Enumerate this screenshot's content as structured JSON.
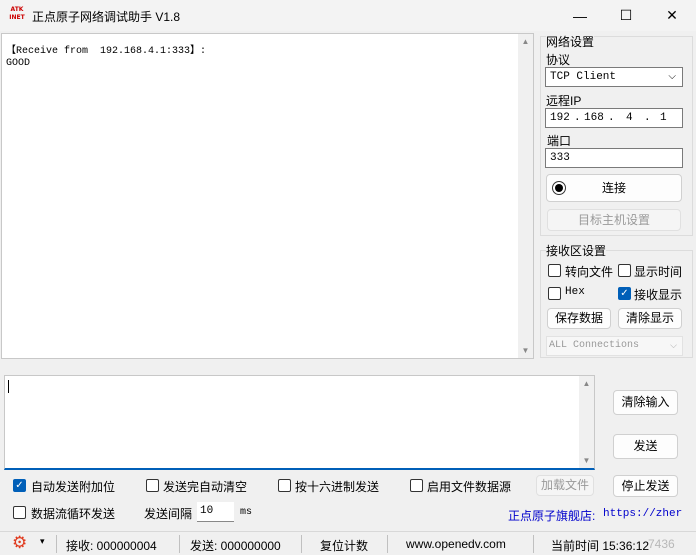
{
  "window": {
    "title": "正点原子网络调试助手 V1.8",
    "icon_text": "ATK\nINET",
    "minimize": "—",
    "maximize": "☐",
    "close": "✕"
  },
  "receive": {
    "text": "【Receive from  192.168.4.1:333】:\nGOOD"
  },
  "net": {
    "group_title": "网络设置",
    "protocol_label": "协议",
    "protocol_value": "TCP Client",
    "remote_ip_label": "远程IP",
    "ip": [
      "192",
      "168",
      "4",
      "1"
    ],
    "port_label": "端口",
    "port_value": "333",
    "connect_label": "连接",
    "target_host_label": "目标主机设置"
  },
  "recv_settings": {
    "group_title": "接收区设置",
    "to_file": "转向文件",
    "show_time": "显示时间",
    "hex": "Hex",
    "recv_show": "接收显示",
    "save_data": "保存数据",
    "clear_display": "清除显示",
    "connections": "ALL Connections"
  },
  "send_panel": {
    "clear_input": "清除输入",
    "send": "发送",
    "stop_send": "停止发送"
  },
  "options": {
    "auto_append": "自动发送附加位",
    "clear_after_send": "发送完自动清空",
    "hex_send": "按十六进制发送",
    "file_source": "启用文件数据源",
    "load_file": "加载文件",
    "loop_send": "数据流循环发送",
    "interval_label": "发送间隔",
    "interval_value": "10",
    "interval_unit": "ms",
    "flagship_label": "正点原子旗舰店:",
    "flagship_url": "https://zher"
  },
  "status": {
    "recv": "接收: 000000004",
    "sent": "发送: 000000000",
    "reset": "复位计数",
    "website": "www.openedv.com",
    "time": "当前时间 15:36:12",
    "watermark": "7436"
  },
  "colors": {
    "accent": "#005fb8",
    "flagship_text": "#0000cc",
    "gear": "#e03a1e"
  }
}
